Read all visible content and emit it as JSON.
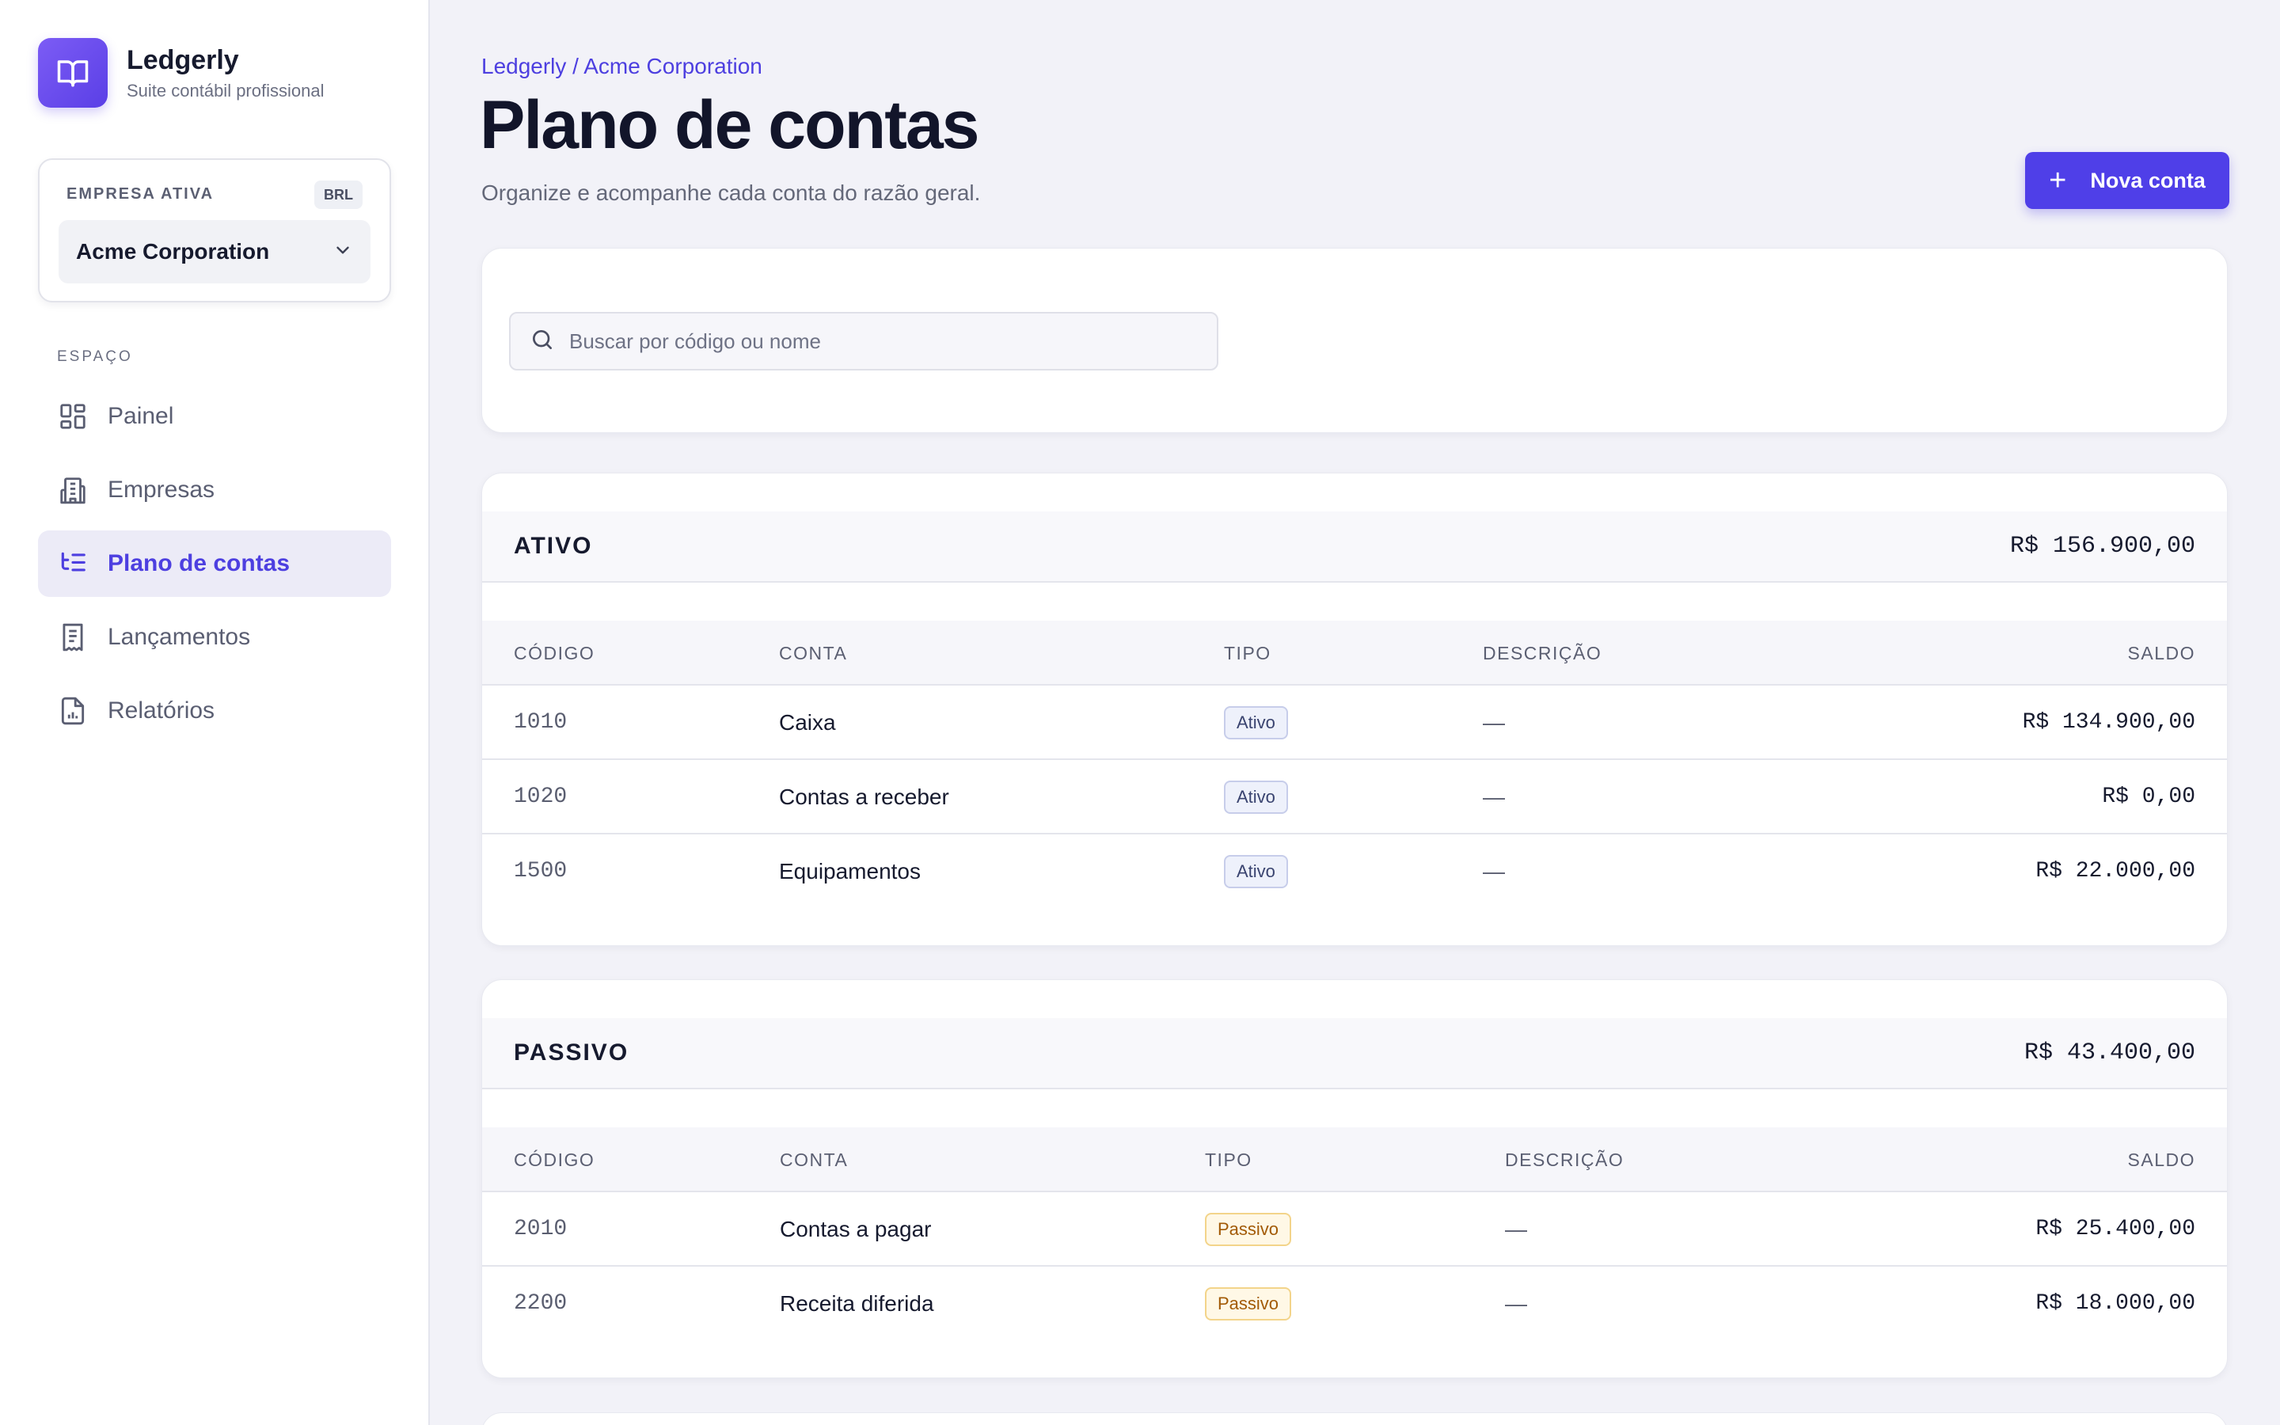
{
  "app": {
    "name": "Ledgerly",
    "tagline": "Suite contábil profissional"
  },
  "company": {
    "label": "EMPRESA ATIVA",
    "currency": "BRL",
    "selected": "Acme Corporation"
  },
  "nav": {
    "section_label": "ESPAÇO",
    "items": [
      {
        "label": "Painel",
        "icon": "dashboard-icon",
        "active": false
      },
      {
        "label": "Empresas",
        "icon": "building-icon",
        "active": false
      },
      {
        "label": "Plano de contas",
        "icon": "list-tree-icon",
        "active": true
      },
      {
        "label": "Lançamentos",
        "icon": "receipt-icon",
        "active": false
      },
      {
        "label": "Relatórios",
        "icon": "report-icon",
        "active": false
      }
    ]
  },
  "header": {
    "breadcrumb": "Ledgerly / Acme Corporation",
    "title": "Plano de contas",
    "subtitle": "Organize e acompanhe cada conta do razão geral.",
    "new_button": "Nova conta"
  },
  "search": {
    "placeholder": "Buscar por código ou nome",
    "value": ""
  },
  "columns": {
    "code": "CÓDIGO",
    "account": "CONTA",
    "type": "TIPO",
    "description": "DESCRIÇÃO",
    "balance": "SALDO"
  },
  "groups": [
    {
      "name": "ATIVO",
      "total": "R$ 156.900,00",
      "rows": [
        {
          "code": "1010",
          "name": "Caixa",
          "type": "Ativo",
          "description": "—",
          "balance": "R$ 134.900,00"
        },
        {
          "code": "1020",
          "name": "Contas a receber",
          "type": "Ativo",
          "description": "—",
          "balance": "R$ 0,00"
        },
        {
          "code": "1500",
          "name": "Equipamentos",
          "type": "Ativo",
          "description": "—",
          "balance": "R$ 22.000,00"
        }
      ]
    },
    {
      "name": "PASSIVO",
      "total": "R$ 43.400,00",
      "rows": [
        {
          "code": "2010",
          "name": "Contas a pagar",
          "type": "Passivo",
          "description": "—",
          "balance": "R$ 25.400,00"
        },
        {
          "code": "2200",
          "name": "Receita diferida",
          "type": "Passivo",
          "description": "—",
          "balance": "R$ 18.000,00"
        }
      ]
    }
  ],
  "colors": {
    "accent": "#4f3fe8",
    "ativo_badge": "#eef1fb",
    "passivo_badge": "#fff8e6"
  }
}
